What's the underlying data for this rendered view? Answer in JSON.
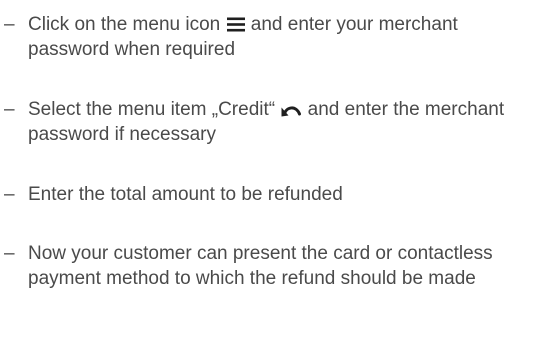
{
  "steps": [
    {
      "bullet": "–",
      "text_before_icon": "Click on the menu icon ",
      "icon": "menu-icon",
      "text_after_icon": " and enter your merchant password when required"
    },
    {
      "bullet": "–",
      "text_before_icon": "Select the menu item „Credit“ ",
      "icon": "return-arrow-icon",
      "text_after_icon": " and enter the merchant password if necessary"
    },
    {
      "bullet": "–",
      "text": "Enter the total amount to be refunded"
    },
    {
      "bullet": "–",
      "text": "Now your customer can present the card or contactless payment method to which the refund should be made"
    }
  ]
}
